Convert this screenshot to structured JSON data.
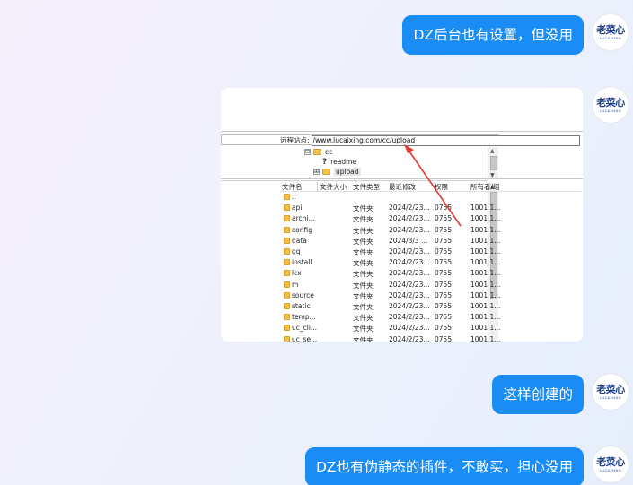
{
  "messages": [
    {
      "text": "DZ后台也有设置，但没用"
    },
    {
      "text": "这样创建的"
    },
    {
      "text": "DZ也有伪静态的插件，不敢买，担心没用"
    }
  ],
  "avatar": {
    "name": "老菜心",
    "sub": "LUCAIXING"
  },
  "screenshot": {
    "remote_label": "远程站点:",
    "remote_path": "/www.lucaixing.com/cc/upload",
    "tree": [
      {
        "label": "cc",
        "type": "folder",
        "expander": "⊟"
      },
      {
        "label": "readme",
        "type": "unknown",
        "expander": ""
      },
      {
        "label": "upload",
        "type": "folder",
        "expander": "⊞"
      }
    ],
    "columns": [
      "文件名",
      "文件大小",
      "文件类型",
      "最近修改",
      "权限",
      "所有者/组"
    ],
    "files": [
      {
        "name": "..",
        "type": "",
        "modified": "",
        "perm": "",
        "owner": ""
      },
      {
        "name": "api",
        "type": "文件夹",
        "modified": "2024/2/23...",
        "perm": "0755",
        "owner": "1001 1..."
      },
      {
        "name": "archi...",
        "type": "文件夹",
        "modified": "2024/2/23...",
        "perm": "0755",
        "owner": "1001 1..."
      },
      {
        "name": "config",
        "type": "文件夹",
        "modified": "2024/2/23...",
        "perm": "0755",
        "owner": "1001 1..."
      },
      {
        "name": "data",
        "type": "文件夹",
        "modified": "2024/3/3 ...",
        "perm": "0755",
        "owner": "1001 1..."
      },
      {
        "name": "gq",
        "type": "文件夹",
        "modified": "2024/2/23...",
        "perm": "0755",
        "owner": "1001 1..."
      },
      {
        "name": "install",
        "type": "文件夹",
        "modified": "2024/2/23...",
        "perm": "0755",
        "owner": "1001 1..."
      },
      {
        "name": "lcx",
        "type": "文件夹",
        "modified": "2024/2/23...",
        "perm": "0755",
        "owner": "1001 1..."
      },
      {
        "name": "m",
        "type": "文件夹",
        "modified": "2024/2/23...",
        "perm": "0755",
        "owner": "1001 1..."
      },
      {
        "name": "source",
        "type": "文件夹",
        "modified": "2024/2/23...",
        "perm": "0755",
        "owner": "1001 1..."
      },
      {
        "name": "static",
        "type": "文件夹",
        "modified": "2024/2/23...",
        "perm": "0755",
        "owner": "1001 1..."
      },
      {
        "name": "temp...",
        "type": "文件夹",
        "modified": "2024/2/23...",
        "perm": "0755",
        "owner": "1001 1..."
      },
      {
        "name": "uc_cli...",
        "type": "文件夹",
        "modified": "2024/2/23...",
        "perm": "0755",
        "owner": "1001 1..."
      },
      {
        "name": "uc_se...",
        "type": "文件夹",
        "modified": "2024/2/23...",
        "perm": "0755",
        "owner": "1001 1..."
      }
    ]
  },
  "colors": {
    "bubble": "#1a8cf5",
    "annotation_arrow": "#e53935"
  }
}
